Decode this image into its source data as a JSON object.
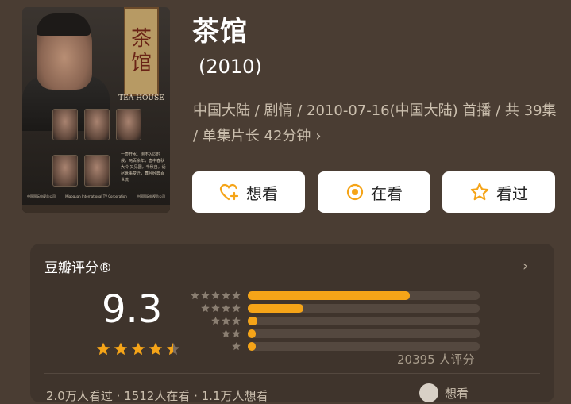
{
  "poster": {
    "title_chars": [
      "茶",
      "馆"
    ],
    "english_title": "TEA HOUSE",
    "blurb": "一壶开水、泡不入同时候，两百余年，壶中春秋大冷 又见国，千秋自。话尽世事变迁，舞台经典百世流",
    "credits_left": "中国国际电视总公司",
    "credits_mid": "Miaoguan International TV Corporation",
    "credits_right": "中国国际电视总公司"
  },
  "movie": {
    "title": "茶馆",
    "year": "(2010)",
    "meta": "中国大陆 / 剧情 / 2010-07-16(中国大陆) 首播 / 共 39集 / 单集片长 42分钟",
    "meta_chevron": "›"
  },
  "actions": [
    {
      "label": "想看",
      "icon": "heart-plus-icon"
    },
    {
      "label": "在看",
      "icon": "target-circle-icon"
    },
    {
      "label": "看过",
      "icon": "star-outline-icon"
    }
  ],
  "rating": {
    "header": "豆瓣评分®",
    "chevron": "›",
    "score": "9.3",
    "stars": 4.5,
    "count_text": "20395 人评分",
    "footer_left": "2.0万人看过 · 1512人在看 · 1.1万人想看",
    "footer_right": "想看",
    "colors": {
      "bar": "#f5a418",
      "track": "#54483f",
      "star": "#f5a418"
    }
  },
  "chart_data": {
    "type": "bar",
    "categories": [
      "5星",
      "4星",
      "3星",
      "2星",
      "1星"
    ],
    "values": [
      0.7,
      0.24,
      0.04,
      0.03,
      0.03
    ],
    "xlim": [
      0,
      1
    ]
  }
}
